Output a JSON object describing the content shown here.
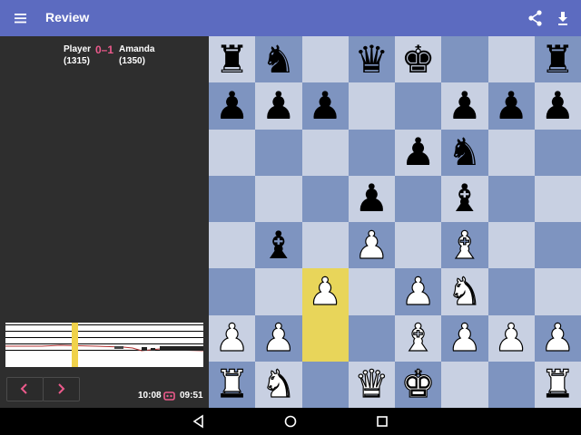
{
  "appbar": {
    "title": "Review"
  },
  "game": {
    "white_name": "Player",
    "white_rating": "(1315)",
    "black_name": "Amanda",
    "black_rating": "(1350)",
    "result": "0–1"
  },
  "clocks": {
    "white": "10:08",
    "black": "09:51"
  },
  "colors": {
    "appbar": "#5c6bc0",
    "light_square": "#c8d0e2",
    "dark_square": "#7e94c0",
    "highlight": "#e8d55a",
    "score": "#ec5a8c",
    "panel": "#2e2e2e"
  },
  "board": {
    "ranks": [
      [
        "br",
        "bn",
        "",
        "bq",
        "bk",
        "",
        "",
        "br"
      ],
      [
        "bp",
        "bp",
        "bp",
        "",
        "",
        "bp",
        "bp",
        "bp"
      ],
      [
        "",
        "",
        "",
        "",
        "bp",
        "bn",
        "",
        ""
      ],
      [
        "",
        "",
        "",
        "bp",
        "",
        "bb",
        "",
        ""
      ],
      [
        "",
        "bb",
        "",
        "wp",
        "",
        "wb",
        "",
        ""
      ],
      [
        "",
        "",
        "wp",
        "",
        "wp",
        "wn",
        "",
        ""
      ],
      [
        "wp",
        "wp",
        "",
        "",
        "wb",
        "wp",
        "wp",
        "wp"
      ],
      [
        "wr",
        "wn",
        "",
        "wq",
        "wk",
        "",
        "",
        "wr"
      ]
    ],
    "highlighted": [
      "c3",
      "c2"
    ]
  },
  "icons": {
    "menu": "menu-icon",
    "share": "share-icon",
    "download": "download-icon",
    "prev": "chevron-left-icon",
    "next": "chevron-right-icon",
    "clock": "alarm-clock-icon",
    "back": "back-icon",
    "home": "home-icon",
    "recents": "recents-icon"
  }
}
